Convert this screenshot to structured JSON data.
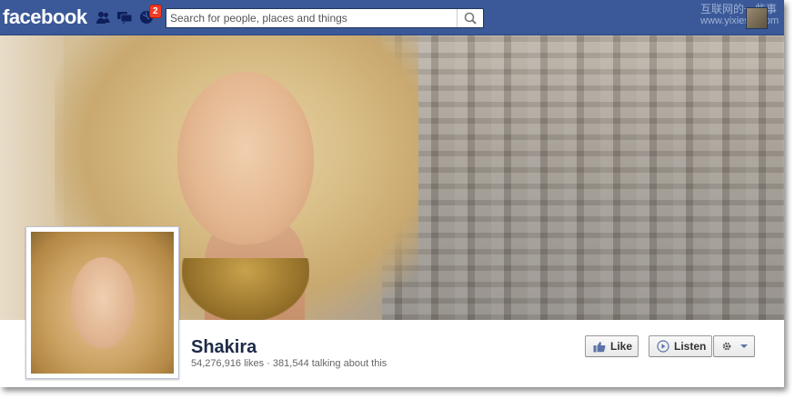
{
  "topbar": {
    "logo": "facebook",
    "notifications_count": "2",
    "search_placeholder": "Search for people, places and things",
    "watermark_line1": "互联网的一些事",
    "watermark_line2": "www.yixieshi.com",
    "icons": [
      "friend-requests-icon",
      "messages-icon",
      "notifications-globe-icon",
      "search-icon"
    ]
  },
  "page": {
    "name": "Shakira",
    "likes": "54,276,916 likes",
    "separator": "·",
    "talking_about": "381,544 talking about this"
  },
  "actions": {
    "like_label": "Like",
    "listen_label": "Listen"
  },
  "colors": {
    "header_blue": "#3b5998",
    "badge_red": "#f03d25",
    "name_color": "#1c2a47"
  }
}
